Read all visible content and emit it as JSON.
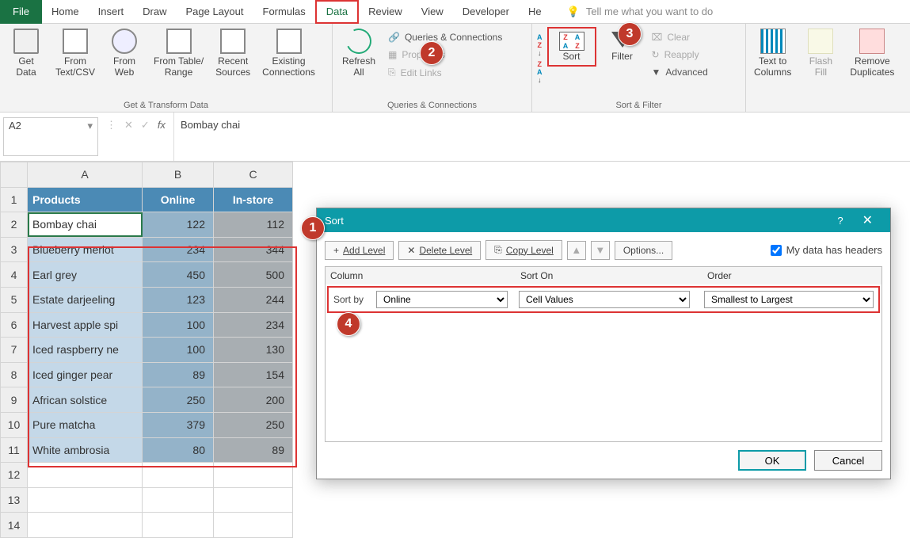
{
  "tabs": {
    "file": "File",
    "items": [
      "Home",
      "Insert",
      "Draw",
      "Page Layout",
      "Formulas",
      "Data",
      "Review",
      "View",
      "Developer",
      "He"
    ],
    "active": "Data",
    "tell_me": "Tell me what you want to do"
  },
  "ribbon": {
    "get_transform": {
      "label": "Get & Transform Data",
      "get_data": "Get\nData",
      "from_csv": "From\nText/CSV",
      "from_web": "From\nWeb",
      "from_table": "From Table/\nRange",
      "recent": "Recent\nSources",
      "existing": "Existing\nConnections"
    },
    "queries": {
      "label": "Queries & Connections",
      "refresh": "Refresh\nAll",
      "qc": "Queries & Connections",
      "props": "Properties",
      "edit": "Edit Links"
    },
    "sort_filter": {
      "label": "Sort & Filter",
      "sort": "Sort",
      "filter": "Filter",
      "clear": "Clear",
      "reapply": "Reapply",
      "advanced": "Advanced"
    },
    "data_tools": {
      "text_cols": "Text to\nColumns",
      "flash": "Flash\nFill",
      "remove_dup": "Remove\nDuplicates"
    }
  },
  "namebox": "A2",
  "formula": "Bombay chai",
  "sheet": {
    "cols": [
      "A",
      "B",
      "C"
    ],
    "header": [
      "Products",
      "Online",
      "In-store"
    ],
    "rows": [
      {
        "n": 1
      },
      {
        "n": 2,
        "p": "Bombay chai",
        "o": 122,
        "s": 112
      },
      {
        "n": 3,
        "p": "Blueberry merlot",
        "o": 234,
        "s": 344
      },
      {
        "n": 4,
        "p": "Earl grey",
        "o": 450,
        "s": 500
      },
      {
        "n": 5,
        "p": "Estate darjeeling",
        "o": 123,
        "s": 244
      },
      {
        "n": 6,
        "p": "Harvest apple spi",
        "o": 100,
        "s": 234
      },
      {
        "n": 7,
        "p": "Iced raspberry ne",
        "o": 100,
        "s": 130
      },
      {
        "n": 8,
        "p": "Iced ginger pear",
        "o": 89,
        "s": 154
      },
      {
        "n": 9,
        "p": "African solstice",
        "o": 250,
        "s": 200
      },
      {
        "n": 10,
        "p": "Pure matcha",
        "o": 379,
        "s": 250
      },
      {
        "n": 11,
        "p": "White ambrosia",
        "o": 80,
        "s": 89
      },
      {
        "n": 12
      },
      {
        "n": 13
      },
      {
        "n": 14
      }
    ]
  },
  "dialog": {
    "title": "Sort",
    "add": "Add Level",
    "delete": "Delete Level",
    "copy": "Copy Level",
    "options": "Options...",
    "headers": "My data has headers",
    "col_h": "Column",
    "son_h": "Sort On",
    "ord_h": "Order",
    "sortby": "Sort by",
    "col_v": "Online",
    "son_v": "Cell Values",
    "ord_v": "Smallest to Largest",
    "ok": "OK",
    "cancel": "Cancel"
  },
  "callouts": {
    "1": "1",
    "2": "2",
    "3": "3",
    "4": "4"
  }
}
